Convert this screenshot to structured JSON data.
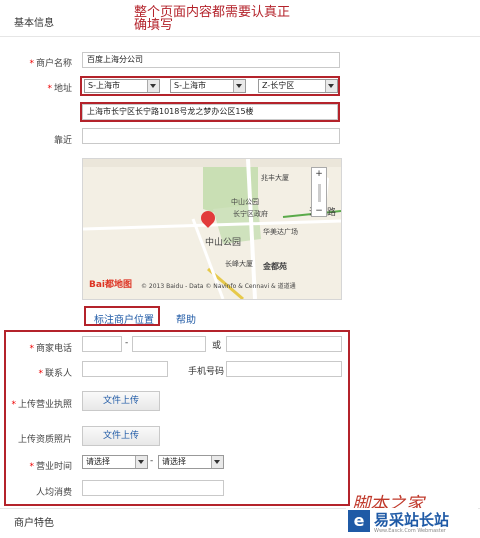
{
  "section_basic": "基本信息",
  "note": "整个页面内容都需要认真正确填写",
  "fields": {
    "merchant_name": {
      "label": "商户名称",
      "value": "百度上海分公司"
    },
    "address": {
      "label": "地址",
      "province": "S-上海市",
      "city": "S-上海市",
      "district": "Z-长宁区",
      "detail": "上海市长宁区长宁路1018号龙之梦办公区15楼"
    },
    "nearby": {
      "label": "靠近",
      "value": ""
    }
  },
  "map": {
    "labels": [
      "兆丰大厦",
      "中山公园",
      "长宁区政府",
      "江苏路",
      "华美达广场",
      "中山公园",
      "长峰大厦",
      "金都苑"
    ],
    "copyright": "© 2013 Baidu - Data © Navinfo & Cennavi & 道道通",
    "logo": "Bai都地图"
  },
  "map_buttons": {
    "mark": "标注商户位置",
    "help": "帮助"
  },
  "contact": {
    "phone_label": "商家电话",
    "dash": "-",
    "or": "或",
    "contact_label": "联系人",
    "mobile_label": "手机号码",
    "license_label": "上传营业执照",
    "upload": "文件上传",
    "qual_label": "上传资质照片",
    "upload2": "文件上传",
    "hours_label": "营业时间",
    "select_placeholder": "请选择",
    "select_placeholder2": "请选择",
    "avg_label": "人均消费"
  },
  "section_features": "商户特色",
  "watermark": {
    "script": "脚本之家",
    "brand": "易采站长站",
    "sub": "Www.Easck.Com Webmaster"
  }
}
